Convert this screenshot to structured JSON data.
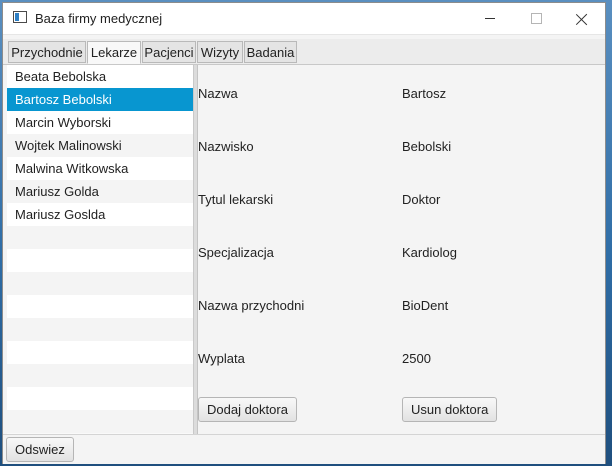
{
  "window": {
    "title": "Baza firmy medycznej"
  },
  "tabs": [
    {
      "label": "Przychodnie"
    },
    {
      "label": "Lekarze"
    },
    {
      "label": "Pacjenci"
    },
    {
      "label": "Wizyty"
    },
    {
      "label": "Badania"
    }
  ],
  "doctors": [
    {
      "name": "Beata Bebolska"
    },
    {
      "name": "Bartosz Bebolski"
    },
    {
      "name": "Marcin Wyborski"
    },
    {
      "name": "Wojtek Malinowski"
    },
    {
      "name": "Malwina Witkowska"
    },
    {
      "name": "Mariusz Golda"
    },
    {
      "name": "Mariusz Goslda"
    }
  ],
  "selected_doctor": "Bartosz Bebolski",
  "active_tab": "Lekarze",
  "details": {
    "name_label": "Nazwa",
    "name_value": "Bartosz",
    "surname_label": "Nazwisko",
    "surname_value": "Bebolski",
    "title_label": "Tytul lekarski",
    "title_value": "Doktor",
    "spec_label": "Specjalizacja",
    "spec_value": "Kardiolog",
    "clinic_label": "Nazwa przychodni",
    "clinic_value": "BioDent",
    "salary_label": "Wyplata",
    "salary_value": "2500"
  },
  "buttons": {
    "add": "Dodaj doktora",
    "remove": "Usun doktora",
    "refresh": "Odswiez"
  },
  "colors": {
    "selection": "#0896d0"
  }
}
